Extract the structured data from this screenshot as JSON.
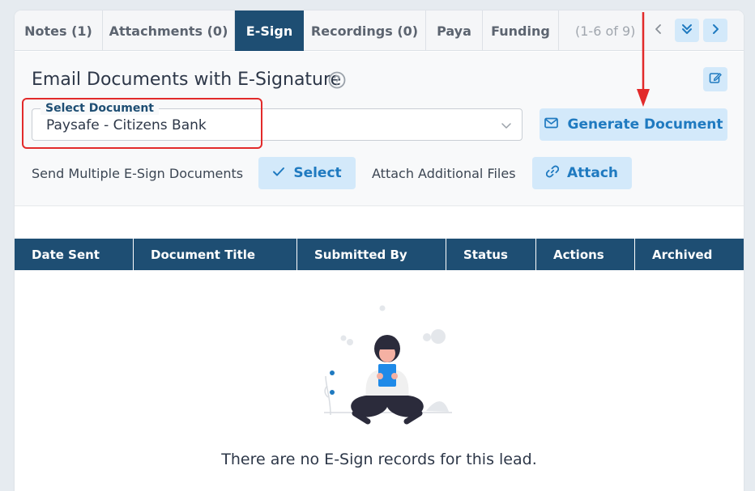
{
  "tabs": [
    {
      "label": "Notes (1)",
      "active": false
    },
    {
      "label": "Attachments (0)",
      "active": false
    },
    {
      "label": "E-Sign",
      "active": true
    },
    {
      "label": "Recordings (0)",
      "active": false
    },
    {
      "label": "Paya",
      "active": false
    },
    {
      "label": "Funding",
      "active": false
    }
  ],
  "tab_counter": "(1-6 of 9)",
  "form": {
    "heading": "Email Documents with E-Signature",
    "select_label": "Select Document",
    "select_value": "Paysafe - Citizens Bank",
    "generate_label": "Generate Document",
    "multi_label": "Send Multiple E-Sign Documents",
    "select_button": "Select",
    "attach_files_label": "Attach Additional Files",
    "attach_button": "Attach"
  },
  "table": {
    "columns": [
      "Date Sent",
      "Document Title",
      "Submitted By",
      "Status",
      "Actions",
      "Archived"
    ]
  },
  "empty_message": "There are no E-Sign records for this lead.",
  "colors": {
    "header_navy": "#1e4e73",
    "accent_blue": "#1f7ac0",
    "button_bg": "#d3e9fa",
    "annotation_red": "#e22a2a"
  },
  "icons": [
    "help-circle-icon",
    "edit-icon",
    "chevron-down-icon",
    "chevron-left-icon",
    "chevron-right-icon",
    "double-chevron-down-icon",
    "mail-icon",
    "check-icon",
    "link-icon"
  ]
}
